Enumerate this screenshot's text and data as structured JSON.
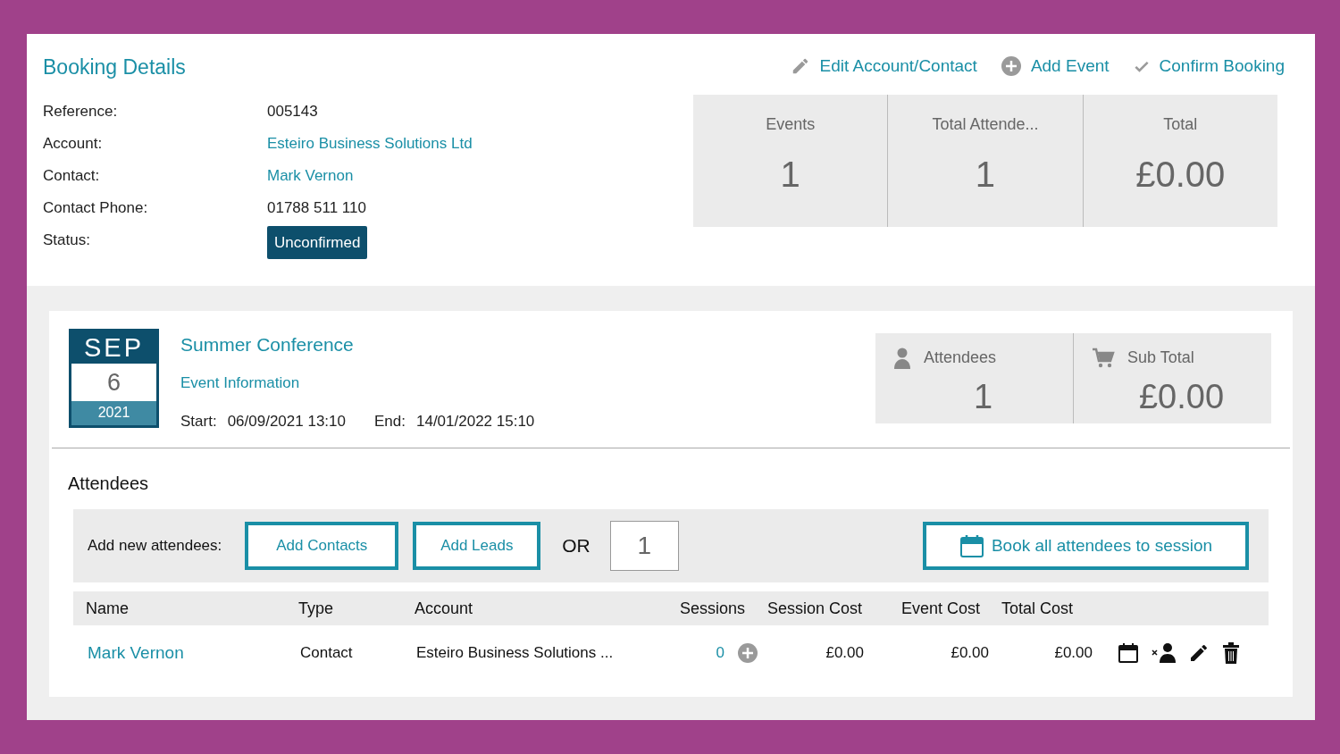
{
  "header": {
    "title": "Booking Details",
    "actions": [
      {
        "kind": "edit",
        "label": "Edit Account/Contact"
      },
      {
        "kind": "add",
        "label": "Add Event"
      },
      {
        "kind": "confirm",
        "label": "Confirm Booking"
      }
    ]
  },
  "details": [
    {
      "label": "Reference:",
      "value": "005143",
      "kind": "text"
    },
    {
      "label": "Account:",
      "value": "Esteiro Business Solutions Ltd",
      "kind": "link"
    },
    {
      "label": "Contact:",
      "value": "Mark Vernon",
      "kind": "link"
    },
    {
      "label": "Contact Phone:",
      "value": "01788 511 110",
      "kind": "text"
    },
    {
      "label": "Status:",
      "value": "Unconfirmed",
      "kind": "badge"
    }
  ],
  "summary": [
    {
      "label": "Events",
      "value": "1"
    },
    {
      "label": "Total Attende...",
      "value": "1"
    },
    {
      "label": "Total",
      "value": "£0.00"
    }
  ],
  "event": {
    "month": "SEP",
    "day": "6",
    "year": "2021",
    "title": "Summer Conference",
    "info_link": "Event Information",
    "start_label": "Start:",
    "start": "06/09/2021 13:10",
    "end_label": "End:",
    "end": "14/01/2022 15:10",
    "stats": [
      {
        "kind": "person",
        "label": "Attendees",
        "value": "1"
      },
      {
        "kind": "cart",
        "label": "Sub Total",
        "value": "£0.00"
      }
    ]
  },
  "attendees": {
    "heading": "Attendees",
    "add_label": "Add new attendees:",
    "buttons": [
      "Add Contacts",
      "Add Leads"
    ],
    "or": "OR",
    "count": "1",
    "book_button": "Book all attendees to session",
    "columns": [
      "Name",
      "Type",
      "Account",
      "Sessions",
      "Session Cost",
      "Event Cost",
      "Total Cost"
    ],
    "rows": [
      {
        "name": "Mark Vernon",
        "type": "Contact",
        "account": "Esteiro Business Solutions ...",
        "sessions": "0",
        "session_cost": "£0.00",
        "event_cost": "£0.00",
        "total_cost": "£0.00"
      }
    ]
  }
}
